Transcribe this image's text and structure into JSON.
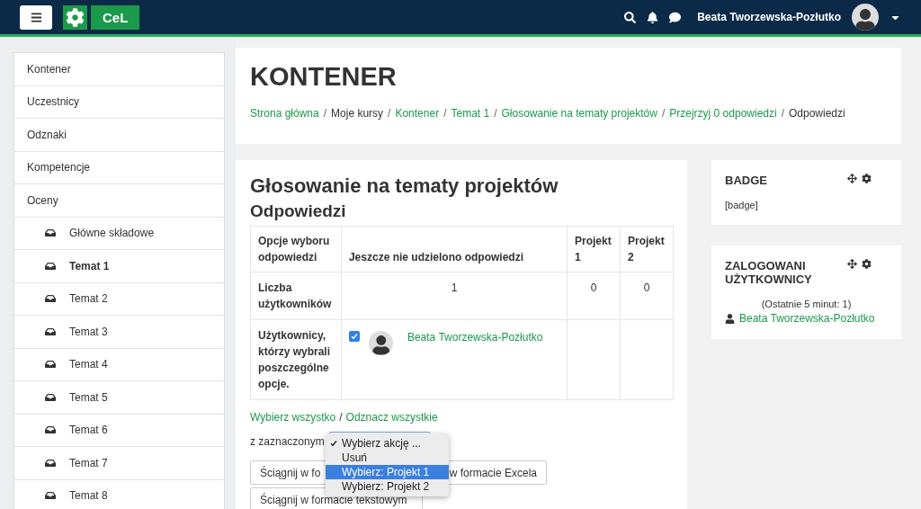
{
  "navbar": {
    "logo_text": "CeL",
    "user_name": "Beata Tworzewska-Pozłutko"
  },
  "sidebar": {
    "items": [
      {
        "label": "Kontener",
        "kind": "plain",
        "selected": false
      },
      {
        "label": "Uczestnicy",
        "kind": "plain",
        "selected": false
      },
      {
        "label": "Odznaki",
        "kind": "plain",
        "selected": false
      },
      {
        "label": "Kompetencje",
        "kind": "plain",
        "selected": false
      },
      {
        "label": "Oceny",
        "kind": "plain",
        "selected": false
      },
      {
        "label": "Główne składowe",
        "kind": "section",
        "selected": false
      },
      {
        "label": "Temat 1",
        "kind": "section",
        "selected": true
      },
      {
        "label": "Temat 2",
        "kind": "section",
        "selected": false
      },
      {
        "label": "Temat 3",
        "kind": "section",
        "selected": false
      },
      {
        "label": "Temat 4",
        "kind": "section",
        "selected": false
      },
      {
        "label": "Temat 5",
        "kind": "section",
        "selected": false
      },
      {
        "label": "Temat 6",
        "kind": "section",
        "selected": false
      },
      {
        "label": "Temat 7",
        "kind": "section",
        "selected": false
      },
      {
        "label": "Temat 8",
        "kind": "section",
        "selected": false
      }
    ]
  },
  "header": {
    "title": "KONTENER",
    "breadcrumb_separator": "/",
    "breadcrumb": [
      {
        "label": "Strona główna",
        "kind": "link"
      },
      {
        "label": "Moje kursy",
        "kind": "text"
      },
      {
        "label": "Kontener",
        "kind": "link"
      },
      {
        "label": "Temat 1",
        "kind": "link"
      },
      {
        "label": "Głosowanie na tematy projektów",
        "kind": "link"
      },
      {
        "label": "Przejrzyj 0 odpowiedzi",
        "kind": "link"
      },
      {
        "label": "Odpowiedzi",
        "kind": "text"
      }
    ]
  },
  "main": {
    "title": "Głosowanie na tematy projektów",
    "subtitle": "Odpowiedzi",
    "table": {
      "columns": [
        "Opcje wyboru odpowiedzi",
        "Jeszcze nie udzielono odpowiedzi",
        "Projekt 1",
        "Projekt 2"
      ],
      "count_row": {
        "label": "Liczba użytkowników",
        "values": [
          "1",
          "0",
          "0"
        ]
      },
      "users_row": {
        "label": "Użytkownicy, którzy wybrali poszczególne opcje.",
        "users": [
          {
            "name": "Beata Tworzewska-Pozłutko",
            "checked": true
          }
        ]
      }
    },
    "select_all": "Wybierz wszystko",
    "separator": "/",
    "deselect_all": "Odznacz wszystkie",
    "with_selected_label": "z zaznaczonym",
    "dropdown": {
      "options": [
        {
          "label": "Wybierz akcję ...",
          "checked": true,
          "highlighted": false
        },
        {
          "label": "Usuń",
          "checked": false,
          "highlighted": false
        },
        {
          "label": "Wybierz: Projekt 1",
          "checked": false,
          "highlighted": true
        },
        {
          "label": "Wybierz: Projekt 2",
          "checked": false,
          "highlighted": false
        }
      ]
    },
    "buttons": [
      {
        "label": "Ściągnij w fo",
        "kind": "left"
      },
      {
        "label": "w formacie Excela",
        "kind": "right"
      },
      {
        "label": "Ściągnij w formacie tekstowym",
        "kind": "left"
      }
    ]
  },
  "blocks": [
    {
      "title": "BADGE",
      "kind": "text",
      "text": "[badge]"
    },
    {
      "title": "ZALOGOWANI UŻYTKOWNICY",
      "kind": "users",
      "text": "(Ostatnie 5 minut: 1)",
      "users": [
        "Beata Tworzewska-Pozłutko"
      ]
    }
  ]
}
